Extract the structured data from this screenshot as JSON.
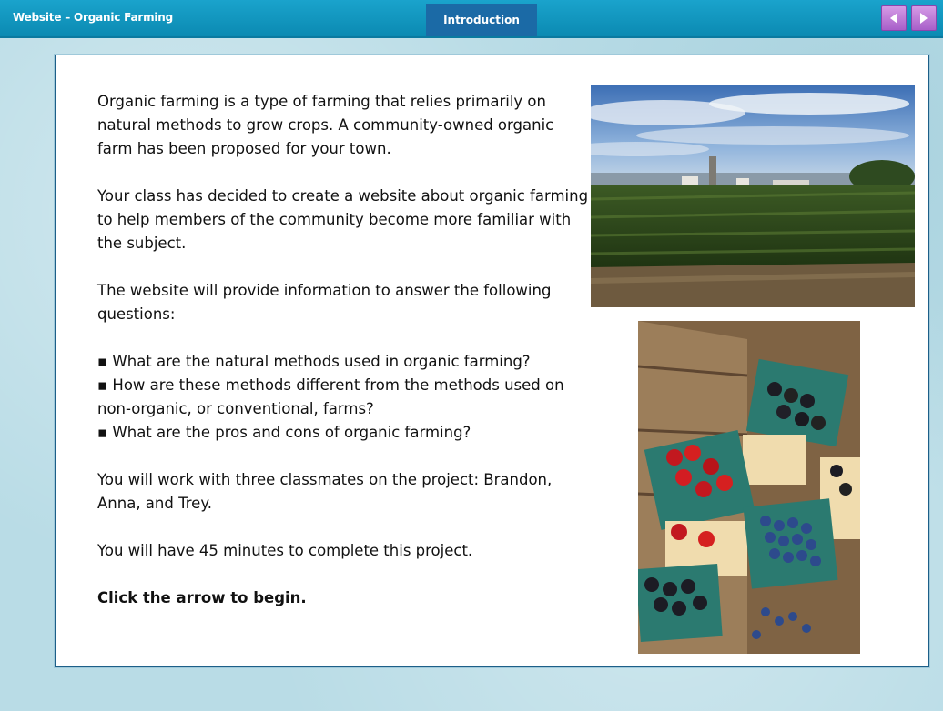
{
  "header": {
    "app_title": "Website – Organic Farming",
    "tab_label": "Introduction",
    "nav": {
      "prev_icon": "arrow-left-icon",
      "next_icon": "arrow-right-icon"
    }
  },
  "content": {
    "paragraphs": [
      "Organic farming is a type of farming that relies primarily on natural methods to grow crops. A community-owned organic farm has been proposed for your town.",
      "Your class has decided to create a website about organic farming to help members of the community become more familiar with the subject.",
      "The website will provide information to answer the following questions:"
    ],
    "bullets": [
      "▪ What are the natural methods used in organic farming?",
      "▪ How are these methods different from the methods used on non-organic, or conventional, farms?",
      "▪ What are the pros and cons of organic farming?"
    ],
    "team_text": "You will work with three classmates on the project: Brandon, Anna, and Trey.",
    "time_text": "You will have 45 minutes to complete this project.",
    "cta_text": "Click the arrow to begin."
  },
  "colors": {
    "header_bg": "#1aa3cc",
    "tab_bg": "#1b6aa6",
    "nav_button": "#b36fd3",
    "page_bg": "#b9dce6"
  }
}
